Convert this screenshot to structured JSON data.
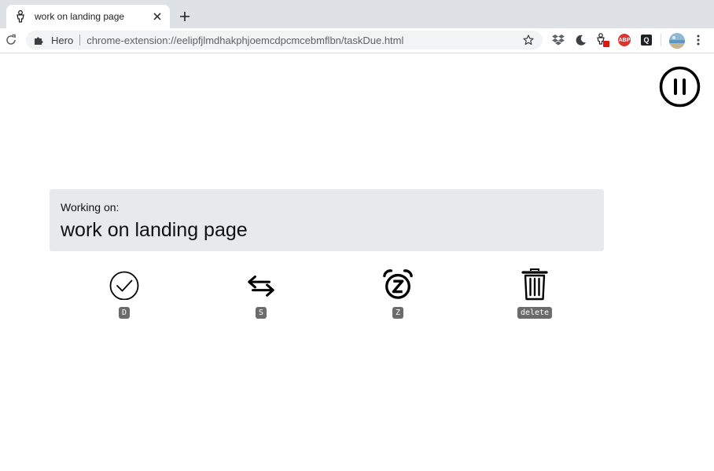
{
  "tab": {
    "title": "work on landing page"
  },
  "omnibox": {
    "origin": "Hero",
    "url": "chrome-extension://eelipfjlmdhakphjoemcdpcmcebmflbn/taskDue.html"
  },
  "extensions": {
    "abp_label": "ABP",
    "q_label": "Q"
  },
  "task": {
    "label": "Working on:",
    "title": "work on landing page"
  },
  "actions": [
    {
      "icon": "check-circle-icon",
      "shortcut": "D"
    },
    {
      "icon": "swap-arrows-icon",
      "shortcut": "S"
    },
    {
      "icon": "alarm-snooze-icon",
      "shortcut": "Z"
    },
    {
      "icon": "trash-icon",
      "shortcut": "delete"
    }
  ],
  "colors": {
    "card_bg": "#e8e9ec",
    "kbd_bg": "#6b6b6b",
    "tabstrip_bg": "#dee1e6"
  }
}
